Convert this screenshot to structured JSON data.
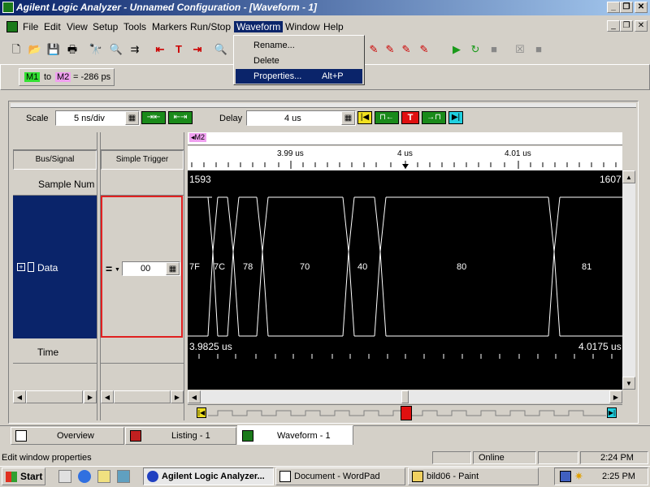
{
  "window": {
    "title": "Agilent Logic Analyzer  - Unnamed Configuration - [Waveform - 1]"
  },
  "menu": {
    "items": [
      "File",
      "Edit",
      "View",
      "Setup",
      "Tools",
      "Markers",
      "Run/Stop",
      "Waveform",
      "Window",
      "Help"
    ]
  },
  "dropdown": {
    "items": [
      {
        "label": "Rename...",
        "shortcut": ""
      },
      {
        "label": "Delete",
        "shortcut": ""
      },
      {
        "label": "Properties...",
        "shortcut": "Alt+P"
      }
    ]
  },
  "marker_bar": {
    "m1": "M1",
    "to": "to",
    "m2": "M2",
    "value": "= -286 ps"
  },
  "waveform": {
    "scale_label": "Scale",
    "scale_value": "5 ns/div",
    "delay_label": "Delay",
    "delay_value": "4 us",
    "marker_flag": "M2",
    "bus_signal_header": "Bus/Signal",
    "trigger_header": "Simple Trigger",
    "sample_num_label": "Sample Num",
    "data_label": "Data",
    "time_label": "Time",
    "trigger_value": "00",
    "trigger_operator": "=",
    "ticks": [
      "3.99 us",
      "4 us",
      "4.01 us"
    ],
    "sample_start": "1593",
    "sample_end": "1607",
    "time_start": "3.9825 us",
    "time_end": "4.0175 us",
    "data_values": [
      "7F",
      "7C",
      "78",
      "70",
      "40",
      "80",
      "81"
    ]
  },
  "tabs": [
    "Overview",
    "Listing - 1",
    "Waveform - 1"
  ],
  "statusbar": {
    "message": "Edit window properties",
    "status": "Online",
    "time": "2:24 PM"
  },
  "taskbar": {
    "start": "Start",
    "buttons": [
      "Agilent Logic Analyzer...",
      "Document - WordPad",
      "bild06 - Paint"
    ],
    "clock": "2:25 PM"
  }
}
